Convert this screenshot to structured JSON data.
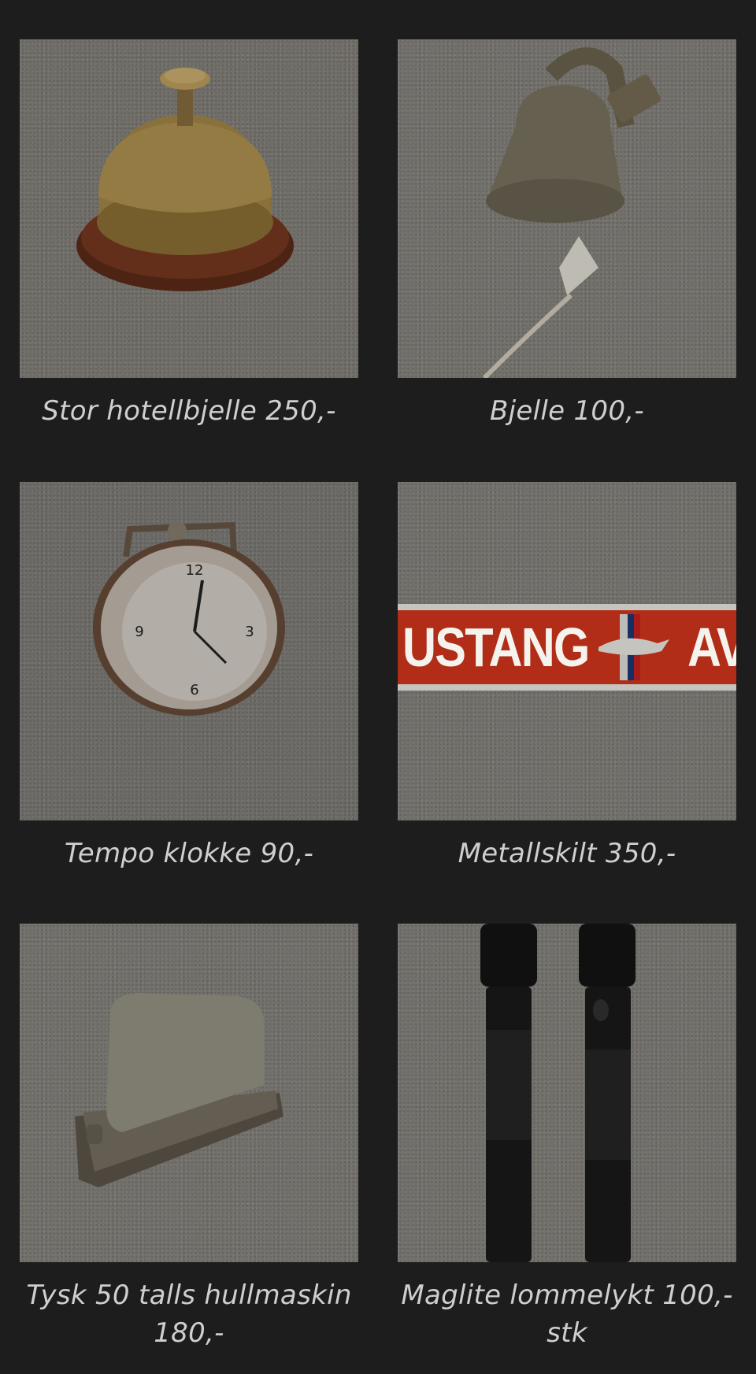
{
  "gallery": {
    "items": [
      {
        "caption": "Stor hotellbjelle 250,-",
        "image": "brass-service-bell"
      },
      {
        "caption": "Bjelle 100,-",
        "image": "hanging-brass-bell"
      },
      {
        "caption": "Tempo klokke 90,-",
        "image": "alarm-clock"
      },
      {
        "caption": "Metallskilt 350,-",
        "image": "mustang-metal-sign",
        "sign_text_left": "USTANG",
        "sign_text_right": "AV"
      },
      {
        "caption": "Tysk 50 talls hullmaskin 180,-",
        "image": "hole-punch"
      },
      {
        "caption": "Maglite lommelykt 100,- stk",
        "image": "maglite-flashlights"
      }
    ]
  },
  "colors": {
    "background": "#1d1d1d",
    "caption_text": "#cfcfcf",
    "sign_red": "#d9381e"
  }
}
